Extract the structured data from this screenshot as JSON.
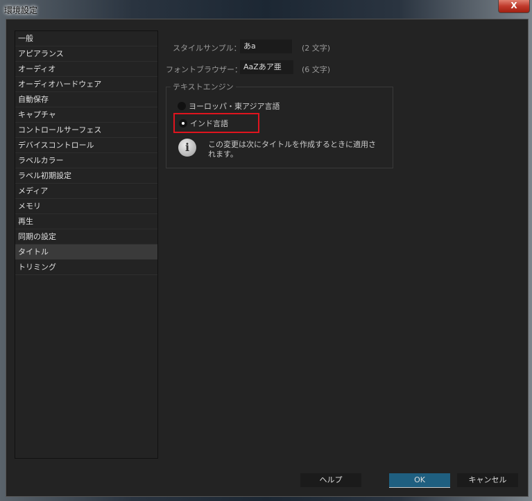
{
  "window": {
    "title": "環境設定",
    "close_label": "X"
  },
  "sidebar": {
    "items": [
      "一般",
      "アピアランス",
      "オーディオ",
      "オーディオハードウェア",
      "自動保存",
      "キャプチャ",
      "コントロールサーフェス",
      "デバイスコントロール",
      "ラベルカラー",
      "ラベル初期設定",
      "メディア",
      "メモリ",
      "再生",
      "同期の設定",
      "タイトル",
      "トリミング"
    ],
    "selected": "タイトル"
  },
  "main": {
    "style_sample": {
      "label": "スタイルサンプル：",
      "value": "あa",
      "count": "(2 文字)"
    },
    "font_browser": {
      "label": "フォントブラウザー：",
      "value": "AaZあア亜",
      "count": "(6 文字)"
    },
    "text_engine": {
      "title": "テキストエンジン",
      "options": [
        "ヨーロッパ・東アジア言語",
        "インド言語"
      ],
      "selected": "インド言語",
      "note": "この変更は次にタイトルを作成するときに適用されます。"
    }
  },
  "footer": {
    "help": "ヘルプ",
    "ok": "OK",
    "cancel": "キャンセル"
  }
}
